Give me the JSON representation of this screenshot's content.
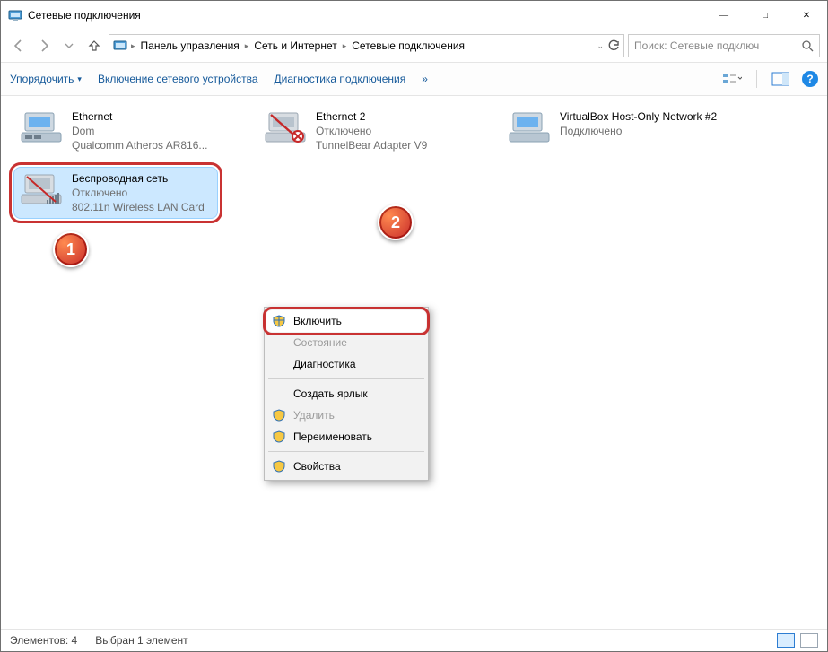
{
  "window": {
    "title": "Сетевые подключения"
  },
  "breadcrumb": {
    "seg1": "Панель управления",
    "seg2": "Сеть и Интернет",
    "seg3": "Сетевые подключения"
  },
  "search": {
    "placeholder": "Поиск: Сетевые подключ"
  },
  "toolbar": {
    "organize": "Упорядочить",
    "enable_device": "Включение сетевого устройства",
    "diagnose": "Диагностика подключения",
    "more": "»"
  },
  "connections": [
    {
      "name": "Ethernet",
      "status": "Dom",
      "adapter": "Qualcomm Atheros AR816..."
    },
    {
      "name": "Ethernet 2",
      "status": "Отключено",
      "adapter": "TunnelBear Adapter V9"
    },
    {
      "name": "VirtualBox Host-Only Network #2",
      "status": "Подключено",
      "adapter": ""
    },
    {
      "name": "Беспроводная сеть",
      "status": "Отключено",
      "adapter": "802.11n Wireless LAN Card"
    }
  ],
  "context_menu": {
    "enable": "Включить",
    "state": "Состояние",
    "diagnostics": "Диагностика",
    "shortcut": "Создать ярлык",
    "delete": "Удалить",
    "rename": "Переименовать",
    "properties": "Свойства"
  },
  "statusbar": {
    "count": "Элементов: 4",
    "selection": "Выбран 1 элемент"
  },
  "markers": {
    "m1": "1",
    "m2": "2"
  }
}
